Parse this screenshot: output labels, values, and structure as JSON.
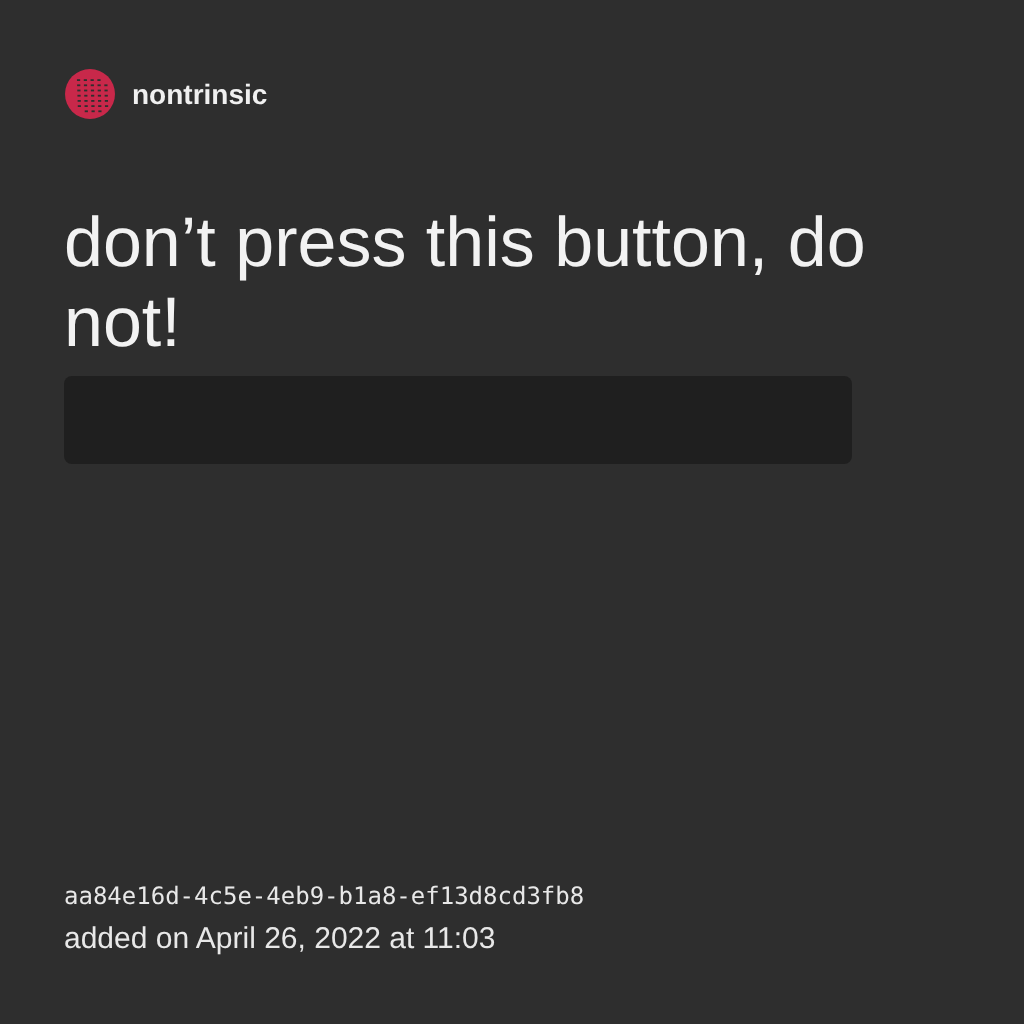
{
  "brand": {
    "name": "nontrinsic"
  },
  "headline": "don’t press this button, do not!",
  "button": {
    "kind": "blank"
  },
  "footer": {
    "id": "aa84e16d-4c5e-4eb9-b1a8-ef13d8cd3fb8",
    "added": "added on April 26, 2022 at 11:03"
  }
}
